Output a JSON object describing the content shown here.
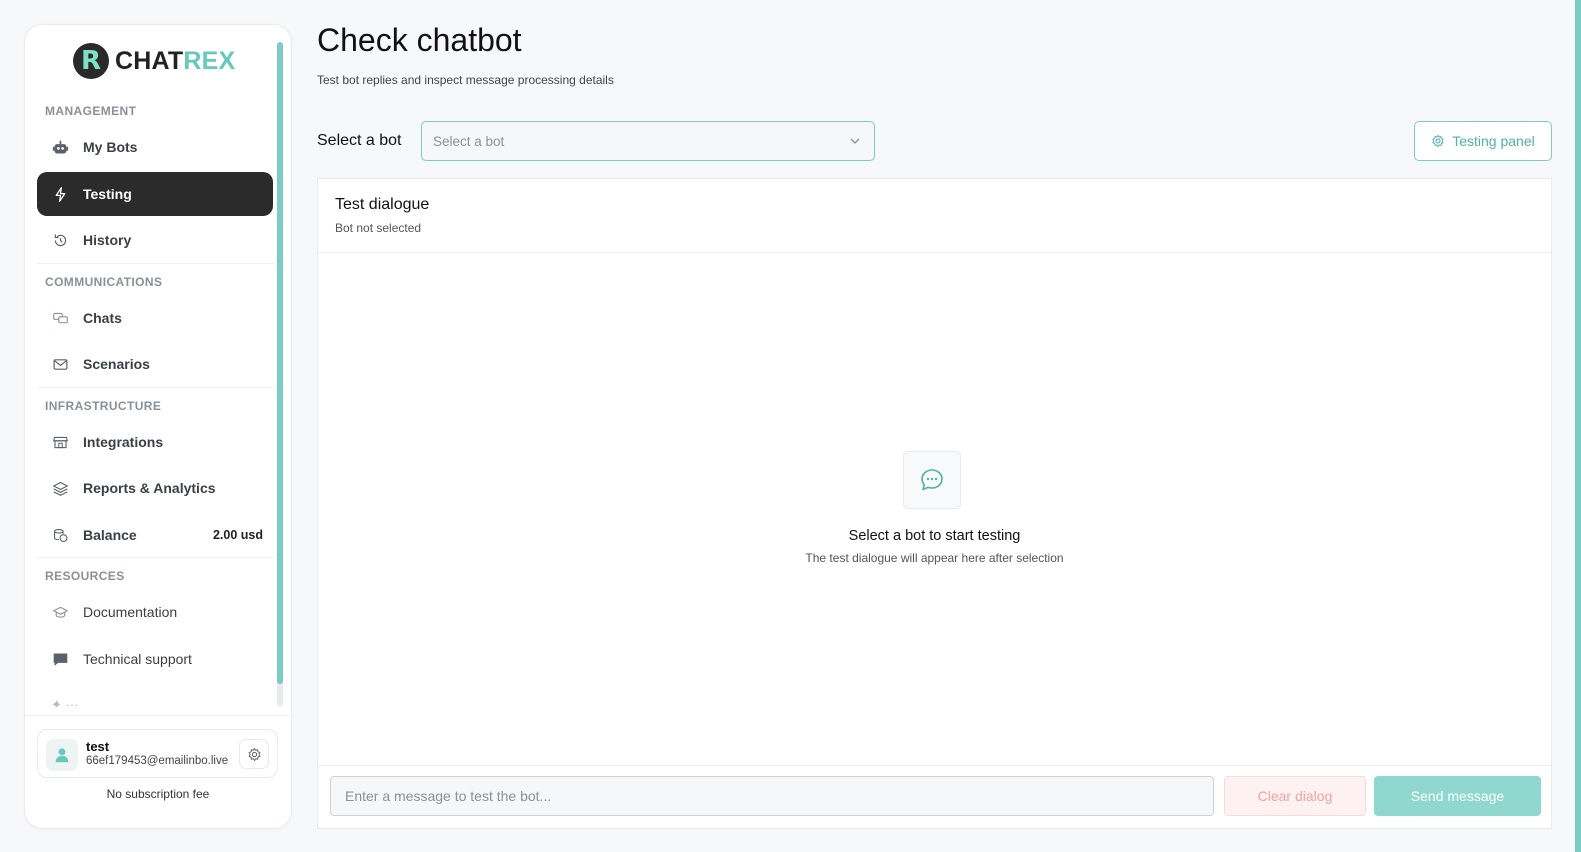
{
  "brand": {
    "logo_letter": "R",
    "name_part1": "CHAT",
    "name_part2": "REX",
    "accent": "#66c9bd",
    "dark": "#2b2b2b"
  },
  "sidebar": {
    "sections": {
      "management": "MANAGEMENT",
      "communications": "COMMUNICATIONS",
      "infrastructure": "INFRASTRUCTURE",
      "resources": "RESOURCES"
    },
    "items": {
      "my_bots": {
        "label": "My Bots",
        "icon": "robot-icon"
      },
      "testing": {
        "label": "Testing",
        "icon": "bolt-icon",
        "active": true
      },
      "history": {
        "label": "History",
        "icon": "clock-icon"
      },
      "chats": {
        "label": "Chats",
        "icon": "chat-bubbles-icon"
      },
      "scenarios": {
        "label": "Scenarios",
        "icon": "envelope-icon"
      },
      "integrations": {
        "label": "Integrations",
        "icon": "store-icon"
      },
      "reports": {
        "label": "Reports & Analytics",
        "icon": "layers-icon"
      },
      "balance": {
        "label": "Balance",
        "icon": "coins-icon",
        "value": "2.00 usd"
      },
      "documentation": {
        "label": "Documentation",
        "icon": "graduation-cap-icon"
      },
      "support": {
        "label": "Technical support",
        "icon": "message-square-icon"
      }
    },
    "user": {
      "name": "test",
      "email": "66ef179453@emailinbo.live"
    },
    "subscription": "No subscription fee"
  },
  "main": {
    "title": "Check chatbot",
    "subtitle": "Test bot replies and inspect message processing details",
    "select_label": "Select a bot",
    "select_placeholder": "Select a bot",
    "testing_panel_button": "Testing panel",
    "dialogue": {
      "title": "Test dialogue",
      "status": "Bot not selected",
      "empty_title": "Select a bot to start testing",
      "empty_subtitle": "The test dialogue will appear here after selection"
    },
    "composer": {
      "placeholder": "Enter a message to test the bot...",
      "clear_label": "Clear dialog",
      "send_label": "Send message"
    }
  }
}
